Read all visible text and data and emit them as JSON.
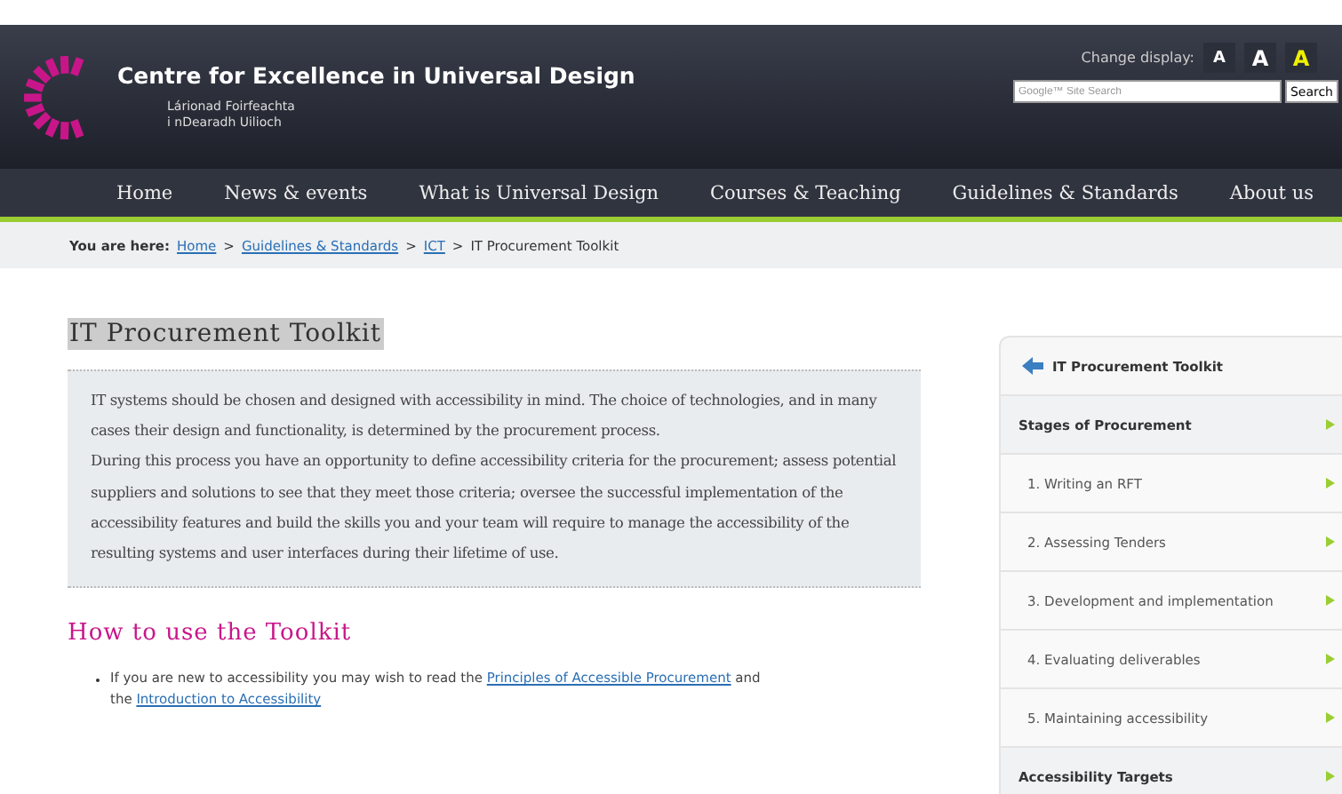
{
  "header": {
    "title": "Centre for Excellence in Universal Design",
    "subtitle_lines": [
      "Lárionad Foirfeachta",
      "i nDearadh Uilioch"
    ],
    "display_label": "Change display:",
    "display_options": [
      {
        "label": "A",
        "kind": "normal",
        "selected": false
      },
      {
        "label": "A",
        "kind": "large",
        "selected": false
      },
      {
        "label": "A",
        "kind": "contrast",
        "selected": false
      }
    ],
    "search": {
      "placeholder": "Google™ Site Search",
      "button": "Search"
    }
  },
  "nav": [
    "Home",
    "News & events",
    "What is Universal Design",
    "Courses & Teaching",
    "Guidelines & Standards",
    "About us"
  ],
  "breadcrumb": {
    "label": "You are here:",
    "links": [
      "Home",
      "Guidelines & Standards",
      "ICT"
    ],
    "current": "IT Procurement Toolkit",
    "separator": ">"
  },
  "page_title": "IT Procurement Toolkit",
  "intro": [
    "IT systems should be chosen and designed with accessibility in mind. The choice of technologies, and in many cases their design and functionality, is determined by the procurement process.",
    "During this process you have an opportunity to define accessibility criteria for the procurement; assess potential suppliers and solutions to see that they meet those criteria; oversee the successful implementation of the accessibility features and build the skills you and your team will require to manage the accessibility of the resulting systems and user interfaces during their lifetime of use."
  ],
  "section_heading": "How to use the Toolkit",
  "bullets": [
    {
      "text": "If you are new to accessibility you may wish to read the ",
      "link1": "Principles of Accessible Procurement",
      "middle": " and the ",
      "link2": "Introduction to Accessibility"
    }
  ],
  "sidebar": {
    "title": "IT Procurement Toolkit",
    "items": [
      {
        "label": "Stages of Procurement",
        "kind": "heading"
      },
      {
        "label": "1. Writing an RFT",
        "kind": "item"
      },
      {
        "label": "2. Assessing Tenders",
        "kind": "item"
      },
      {
        "label": "3. Development and implementation",
        "kind": "item"
      },
      {
        "label": "4. Evaluating deliverables",
        "kind": "item"
      },
      {
        "label": "5. Maintaining accessibility",
        "kind": "item"
      },
      {
        "label": "Accessibility Targets",
        "kind": "heading"
      }
    ]
  }
}
